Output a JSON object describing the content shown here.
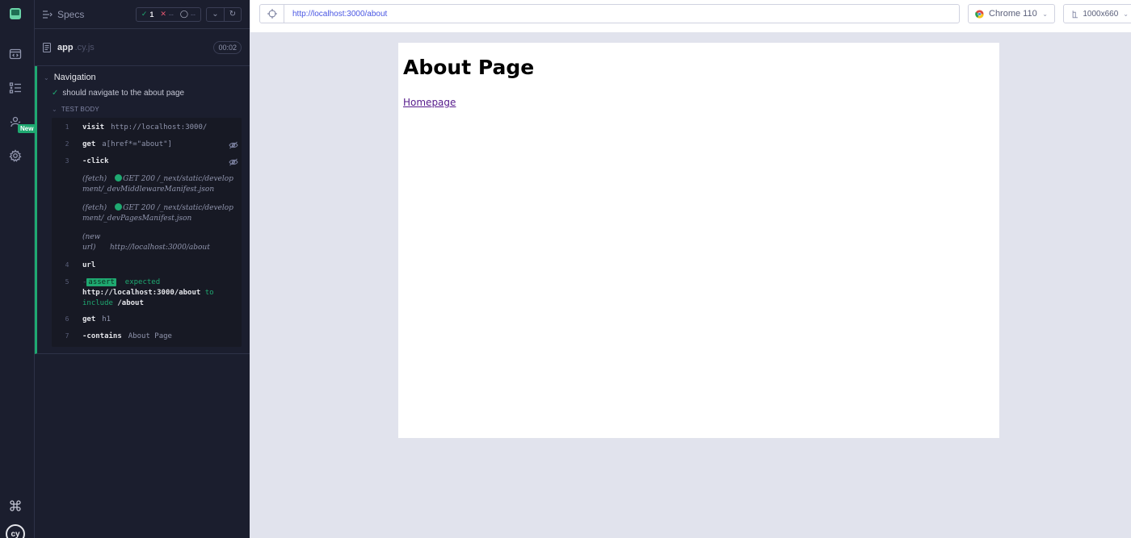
{
  "sidebar": {
    "new_badge": "New",
    "logo_text": "cy",
    "icons": [
      "cypress-app-icon",
      "runs-icon",
      "specs-list-icon",
      "debug-icon",
      "settings-icon",
      "keyboard-shortcuts-icon"
    ]
  },
  "reporter": {
    "specs_label": "Specs",
    "stats": {
      "passed": "1",
      "failed": "--",
      "pending": "--"
    },
    "file": {
      "name": "app",
      "ext": ".cy.js",
      "duration": "00:02"
    },
    "suite_title": "Navigation",
    "test_title": "should navigate to the about page",
    "test_body_label": "TEST BODY",
    "commands": [
      {
        "num": "1",
        "name": "visit",
        "msg": "http://localhost:3000/"
      },
      {
        "num": "2",
        "name": "get",
        "msg": "a[href*=\"about\"]"
      },
      {
        "num": "3",
        "name": "-click",
        "msg": ""
      },
      {
        "num": "4",
        "name": "url",
        "msg": ""
      },
      {
        "num": "5",
        "name": "-",
        "msg": ""
      },
      {
        "num": "6",
        "name": "get",
        "msg": "h1"
      },
      {
        "num": "7",
        "name": "-contains",
        "msg": "About Page"
      }
    ],
    "subcommands": [
      {
        "type": "(fetch)",
        "status": "GET 200",
        "path": "/_next/static/development/_devMiddlewareManifest.json"
      },
      {
        "type": "(fetch)",
        "status": "GET 200",
        "path": "/_next/static/development/_devPagesManifest.json"
      },
      {
        "type": "(new url)",
        "url": "http://localhost:3000/about"
      }
    ],
    "assert": {
      "tag": "assert",
      "expected": "expected",
      "actual": "http://localhost:3000/about",
      "to": "to",
      "include": "include",
      "value": "/about"
    }
  },
  "browser": {
    "url": "http://localhost:3000/about",
    "name": "Chrome 110",
    "viewport": "1000x660"
  },
  "aut": {
    "heading": "About Page",
    "link": "Homepage"
  },
  "colors": {
    "pass": "#1fa971",
    "fail": "#e45770",
    "url": "#4956e3",
    "panel": "#1b1e2e"
  }
}
